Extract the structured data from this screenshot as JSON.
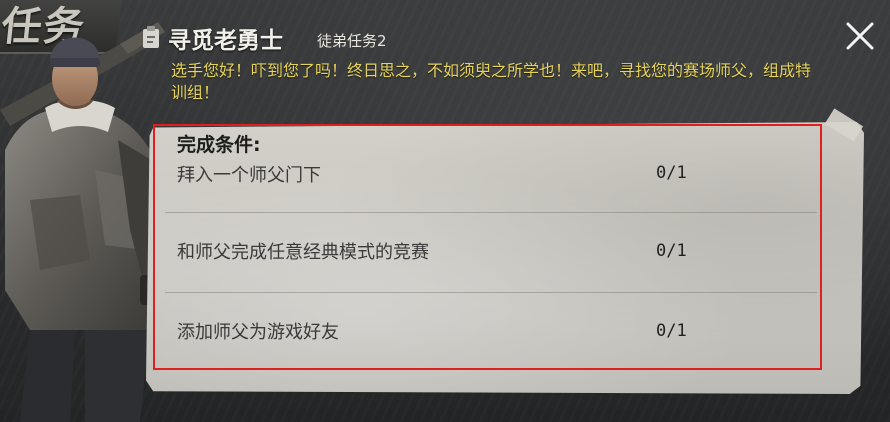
{
  "corner": {
    "title": "任务"
  },
  "quest": {
    "title": "寻觅老勇士",
    "subtitle": "徒弟任务2",
    "description": "选手您好！吓到您了吗！终日思之，不如须臾之所学也！来吧，寻找您的赛场师父，组成特训组！"
  },
  "conditions": {
    "heading": "完成条件:",
    "items": [
      {
        "label": "拜入一个师父门下",
        "progress": "0/1"
      },
      {
        "label": "和师父完成任意经典模式的竞赛",
        "progress": "0/1"
      },
      {
        "label": "添加师父为游戏好友",
        "progress": "0/1"
      }
    ]
  },
  "icons": {
    "quest": "quest-scroll-icon",
    "close": "close-icon"
  },
  "colors": {
    "description": "#e6d35a",
    "highlight_border": "#e01f1f",
    "paper": "#cdcac3"
  }
}
